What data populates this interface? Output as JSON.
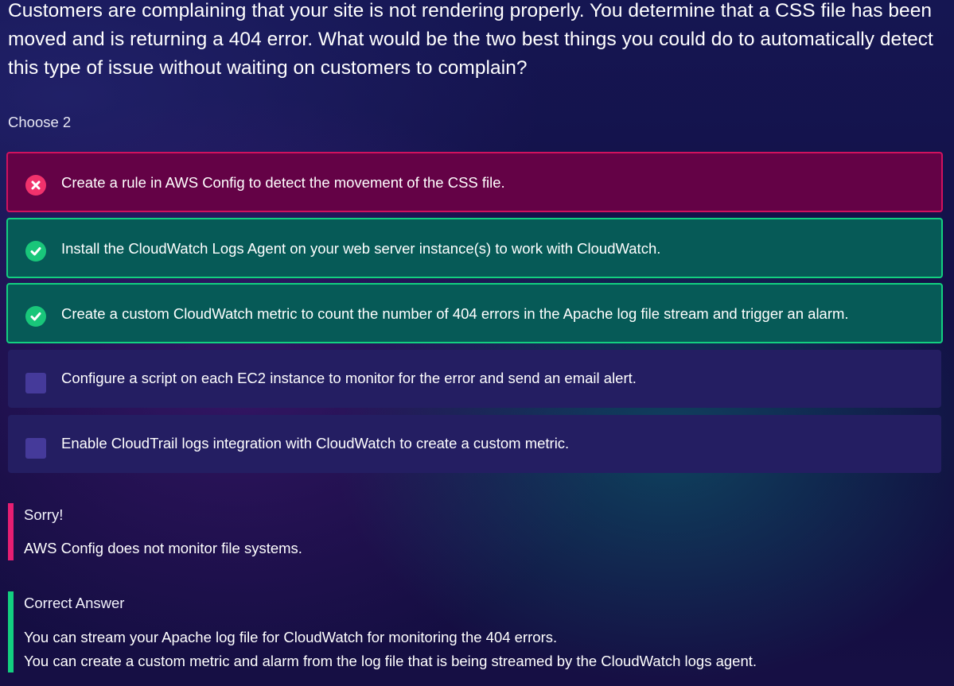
{
  "question": {
    "text": "Customers are complaining that your site is not rendering properly. You determine that a CSS file has been moved and is returning a 404 error. What would be the two best things you could do to automatically detect this type of issue without waiting on customers to complain?",
    "instruction": "Choose 2"
  },
  "options": [
    {
      "label": "Create a rule in AWS Config to detect the movement of the CSS file.",
      "state": "wrong",
      "icon": "x-circle-icon"
    },
    {
      "label": "Install the CloudWatch Logs Agent on your web server instance(s) to work with CloudWatch.",
      "state": "correct",
      "icon": "check-circle-icon"
    },
    {
      "label": "Create a custom CloudWatch metric to count the number of 404 errors in the Apache log file stream and trigger an alarm.",
      "state": "correct",
      "icon": "check-circle-icon"
    },
    {
      "label": "Configure a script on each EC2 instance to monitor for the error and send an email alert.",
      "state": "unselected",
      "icon": "checkbox-icon"
    },
    {
      "label": "Enable CloudTrail logs integration with CloudWatch to create a custom metric.",
      "state": "unselected",
      "icon": "checkbox-icon"
    }
  ],
  "feedback": {
    "sorry": {
      "heading": "Sorry!",
      "lines": [
        "AWS Config does not monitor file systems."
      ]
    },
    "correct_answer": {
      "heading": "Correct Answer",
      "lines": [
        "You can stream your Apache log file for CloudWatch for monitoring the 404 errors.",
        "You can create a custom metric and alarm from the log file that is being streamed by the CloudWatch logs agent."
      ]
    }
  },
  "colors": {
    "wrong_accent": "#e61e72",
    "correct_accent": "#13cf80",
    "wrong_bg": "#640246",
    "correct_bg": "#065a57",
    "neutral_bg": "#241e62",
    "checkbox": "#453a9a"
  }
}
